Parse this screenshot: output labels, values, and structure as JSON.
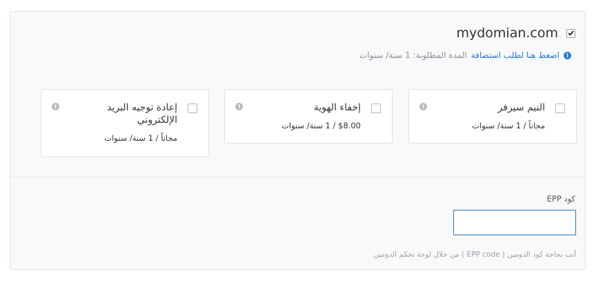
{
  "domain": {
    "name": "mydomian.com",
    "checked": true
  },
  "hosting": {
    "link_text": "اضغط هنا لطلب استضافة",
    "period_text": "المدة المطلوبة: 1 سنة/ سنوات"
  },
  "addons": [
    {
      "title": "النيم سيرفر",
      "price": "مجاناً / 1 سنة/ سنوات"
    },
    {
      "title": "إخفاء الهوية",
      "price": "$8.00 / 1 سنة/ سنوات"
    },
    {
      "title": "إعادة توجيه البريد الإلكتروني",
      "price": "مجاناً / 1 سنة/ سنوات"
    }
  ],
  "epp": {
    "label": "كود EPP",
    "value": "",
    "hint": "أنت بحاجة كود الدومين ( EPP code ) من خلال لوحة تحكم الدومين"
  },
  "colors": {
    "accent": "#2a7ad6",
    "input_border": "#2a6fb6",
    "panel_bg": "#f8f9fa"
  }
}
